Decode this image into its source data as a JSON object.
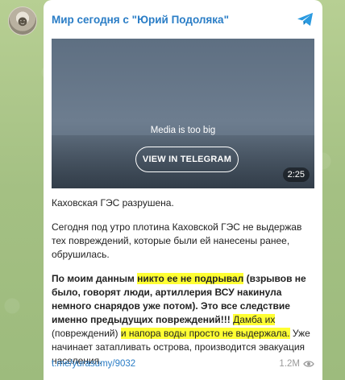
{
  "channel": {
    "name": "Мир сегодня с \"Юрий Подоляка\""
  },
  "media": {
    "message": "Media is too big",
    "button_label": "VIEW IN TELEGRAM",
    "duration": "2:25"
  },
  "post": {
    "title": "Каховская ГЭС разрушена.",
    "p1": "Сегодня под утро плотина Каховской ГЭС не выдержав тех повреждений, которые были ей нанесены ранее, обрушилась.",
    "p2_a": "По моим данным ",
    "p2_hl1": "никто ее не подрывал",
    "p2_b": " (взрывов не было, говорят люди, артиллерия ВСУ накинула немного снарядов уже потом). Это все следствие именно предыдущих повреждений!!!",
    "p2_c": " ",
    "p2_hl2": "Дамба их",
    "p2_d": " (повреждений) ",
    "p2_hl3": "и напора воды просто не выдержала.",
    "p2_e": " Уже начинает затапливать острова, производится эвакуация населения."
  },
  "footer": {
    "link": "t.me/yurasumy/9032",
    "views": "1.2M"
  },
  "icons": {
    "avatar": "channel-avatar",
    "telegram": "telegram-icon",
    "views": "eye-icon"
  },
  "colors": {
    "link": "#2a7dc6",
    "highlight": "#ffff33",
    "background": "#a9c48a"
  }
}
